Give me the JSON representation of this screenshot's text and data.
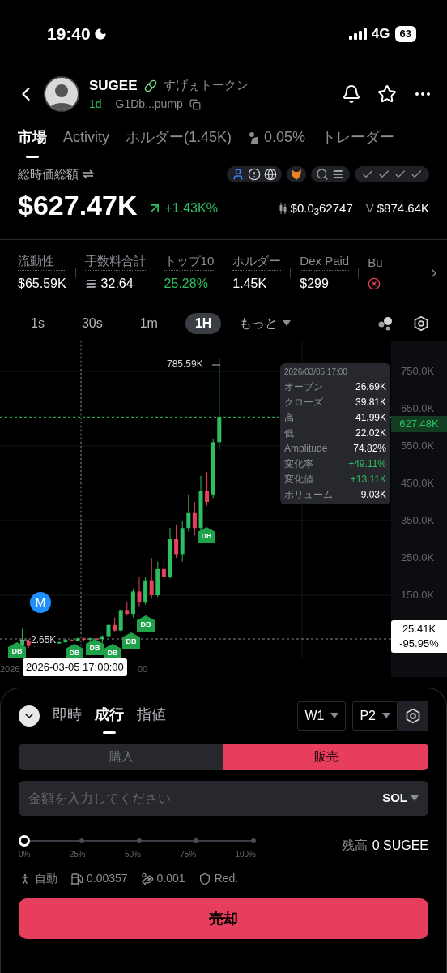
{
  "status_bar": {
    "time": "19:40",
    "network": "4G",
    "battery": "63"
  },
  "header": {
    "symbol": "SUGEE",
    "name": "すげぇトークン",
    "age": "1d",
    "address": "G1Db...pump"
  },
  "tabs": [
    {
      "label": "市場",
      "selected": true,
      "kind": "text"
    },
    {
      "label": "Activity",
      "selected": false,
      "kind": "text"
    },
    {
      "label": "ホルダー(1.45K)",
      "selected": false,
      "kind": "text"
    },
    {
      "label": "0.05%",
      "selected": false,
      "kind": "insider"
    },
    {
      "label": "トレーダー",
      "selected": false,
      "kind": "text"
    }
  ],
  "market_cap": {
    "label": "総時価総額",
    "value": "$627.47K",
    "change": "+1.43K%",
    "price": "$0.0$_{3}$62747",
    "volume_label": "V",
    "volume": "$874.64K"
  },
  "stats": [
    {
      "label": "流動性",
      "value": "$65.59K",
      "kind": "plain"
    },
    {
      "label": "手数料合計",
      "value": "32.64",
      "kind": "sol"
    },
    {
      "label": "トップ10",
      "value": "25.28%",
      "kind": "positive"
    },
    {
      "label": "ホルダー",
      "value": "1.45K",
      "kind": "plain"
    },
    {
      "label": "Dex Paid",
      "value": "$299",
      "kind": "plain"
    },
    {
      "label": "Bu",
      "kind": "flag",
      "ok": false
    }
  ],
  "timeframes": [
    {
      "label": "1s",
      "selected": false
    },
    {
      "label": "30s",
      "selected": false
    },
    {
      "label": "1m",
      "selected": false
    },
    {
      "label": "1H",
      "selected": true
    }
  ],
  "more": "もっと",
  "chart": {
    "y_ticks": [
      "750.0K",
      "650.0K",
      "550.0K",
      "450.0K",
      "350.0K",
      "250.0K",
      "150.0K"
    ],
    "current_price": "627.48K",
    "high_label": "785.59K",
    "low_label": "2.65K",
    "marker": "M",
    "signals": [
      "DB",
      "DB",
      "DB",
      "DB",
      "DB",
      "DB",
      "DB"
    ],
    "cursor_price": "25.41K",
    "cursor_change": "-95.95%",
    "cursor_time": "2026-03-05 17:00:00",
    "x_labels": [
      "2026",
      "00"
    ],
    "tooltip": {
      "title": "2026/03/05 17:00",
      "rows": [
        {
          "label": "オープン",
          "value": "26.69K",
          "positive": false
        },
        {
          "label": "クローズ",
          "value": "39.81K",
          "positive": false
        },
        {
          "label": "高",
          "value": "41.99K",
          "positive": false
        },
        {
          "label": "低",
          "value": "22.02K",
          "positive": false
        },
        {
          "label": "Amplitude",
          "value": "74.82%",
          "positive": false
        },
        {
          "label": "変化率",
          "value": "+49.11%",
          "positive": true
        },
        {
          "label": "変化値",
          "value": "+13.11K",
          "positive": true
        },
        {
          "label": "ボリューム",
          "value": "9.03K",
          "positive": false
        }
      ]
    }
  },
  "trade": {
    "modes": [
      {
        "label": "即時",
        "selected": false
      },
      {
        "label": "成行",
        "selected": true
      },
      {
        "label": "指値",
        "selected": false
      }
    ],
    "wallet": "W1",
    "preset": "P2",
    "sides": [
      {
        "label": "購入",
        "selected": false
      },
      {
        "label": "販売",
        "selected": true
      }
    ],
    "amount": {
      "placeholder": "金額を入力してください",
      "currency": "SOL"
    },
    "slider": {
      "level": 0,
      "marks": [
        "0%",
        "25%",
        "50%",
        "75%",
        "100%"
      ]
    },
    "balance_label": "残高",
    "balance": "0 SUGEE",
    "settings": [
      {
        "kind": "auto",
        "value": "自動"
      },
      {
        "kind": "gas",
        "value": "0.00357"
      },
      {
        "kind": "tip",
        "value": "0.001"
      },
      {
        "kind": "mev",
        "value": "Red."
      }
    ],
    "submit": "売却"
  }
}
